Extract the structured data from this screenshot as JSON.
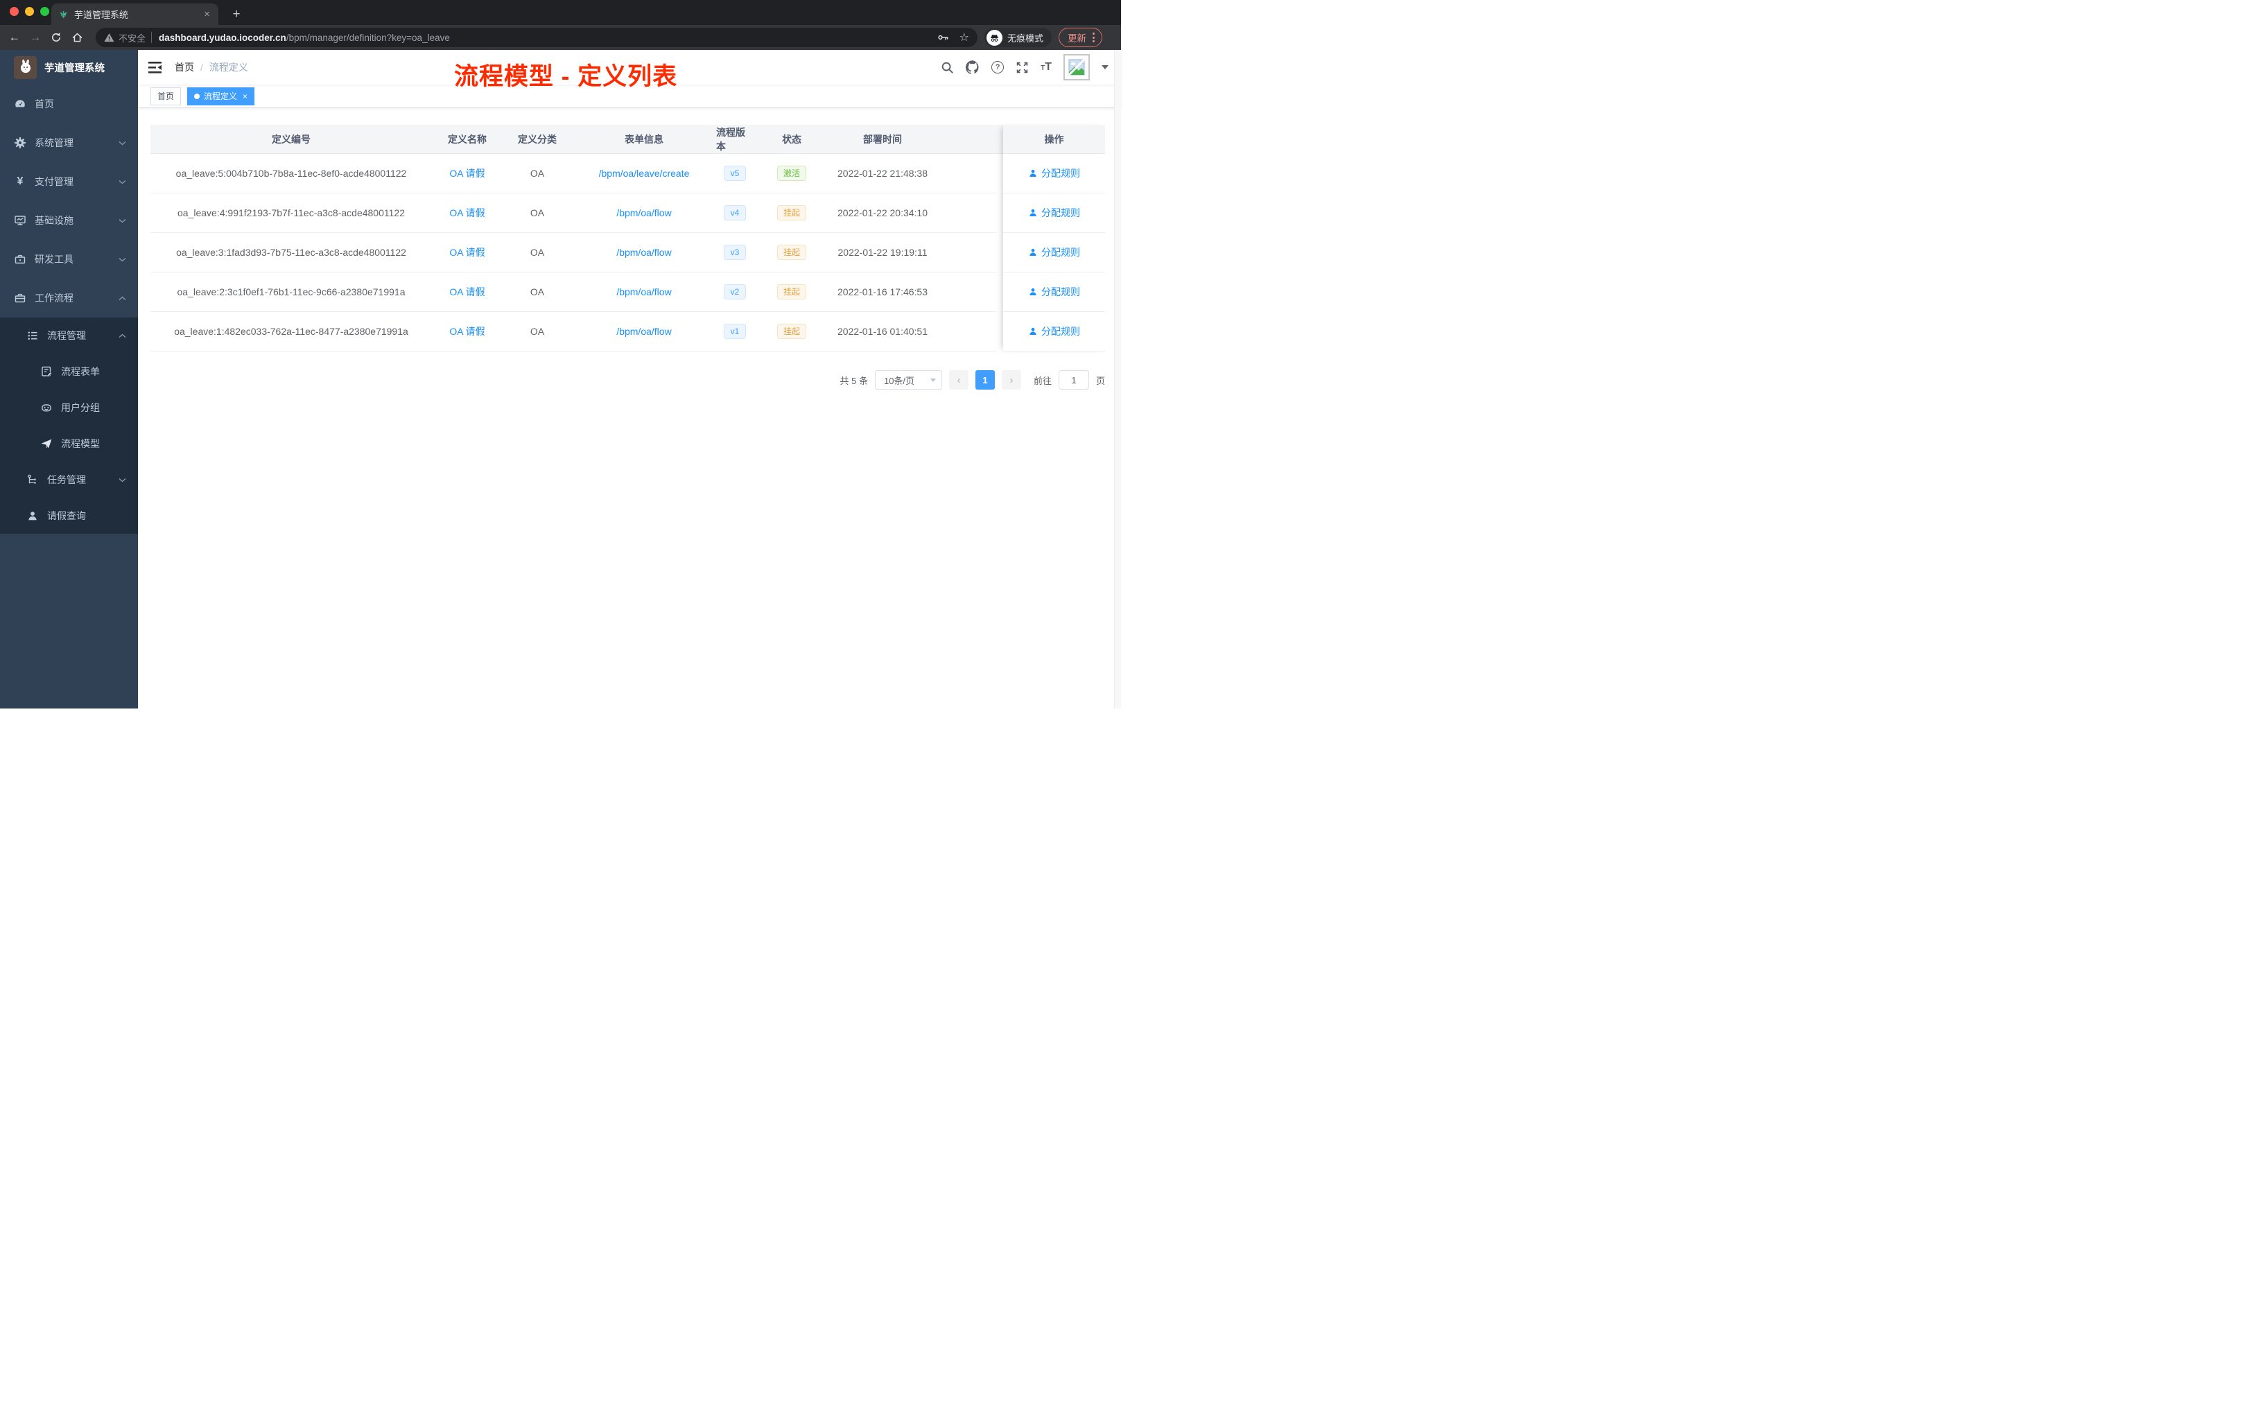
{
  "colors": {
    "accent": "#409eff",
    "link": "#1890ff",
    "success_green": "#67c23a",
    "warning_orange": "#e6a23c",
    "annotation_red": "#ff2b00",
    "sidebar_bg": "#304156",
    "submenu_bg": "#1f2d3d",
    "traffic_red": "#ff5f57",
    "traffic_yellow": "#febc2e",
    "traffic_green": "#28c840",
    "update_red": "#f08f87"
  },
  "browser": {
    "tab_title": "芋道管理系统",
    "new_tab": "+",
    "close_tab": "×",
    "back": "←",
    "forward": "→",
    "security_label": "不安全",
    "url_domain": "dashboard.yudao.iocoder.cn",
    "url_path": "/bpm/manager/definition?key=oa_leave",
    "star": "☆",
    "incognito_label": "无痕模式",
    "update_label": "更新"
  },
  "sidebar": {
    "title": "芋道管理系统",
    "items": [
      {
        "label": "首页"
      },
      {
        "label": "系统管理"
      },
      {
        "label": "支付管理"
      },
      {
        "label": "基础设施"
      },
      {
        "label": "研发工具"
      },
      {
        "label": "工作流程"
      },
      {
        "label": "流程管理"
      },
      {
        "label": "流程表单"
      },
      {
        "label": "用户分组"
      },
      {
        "label": "流程模型"
      },
      {
        "label": "任务管理"
      },
      {
        "label": "请假查询"
      }
    ],
    "yen_icon": "¥"
  },
  "navbar": {
    "breadcrumb": [
      "首页",
      "流程定义"
    ],
    "separator": "/"
  },
  "annotation": "流程模型 - 定义列表",
  "tags": [
    {
      "label": "首页"
    },
    {
      "label": "流程定义",
      "close": "×"
    }
  ],
  "table": {
    "columns": [
      "定义编号",
      "定义名称",
      "定义分类",
      "表单信息",
      "流程版本",
      "状态",
      "部署时间",
      "操作"
    ],
    "action_label": "分配规则",
    "rows": [
      {
        "id": "oa_leave:5:004b710b-7b8a-11ec-8ef0-acde48001122",
        "name": "OA 请假",
        "category": "OA",
        "form": "/bpm/oa/leave/create",
        "version": "v5",
        "status": "激活",
        "status_type": "success",
        "time": "2022-01-22 21:48:38"
      },
      {
        "id": "oa_leave:4:991f2193-7b7f-11ec-a3c8-acde48001122",
        "name": "OA 请假",
        "category": "OA",
        "form": "/bpm/oa/flow",
        "version": "v4",
        "status": "挂起",
        "status_type": "warning",
        "time": "2022-01-22 20:34:10"
      },
      {
        "id": "oa_leave:3:1fad3d93-7b75-11ec-a3c8-acde48001122",
        "name": "OA 请假",
        "category": "OA",
        "form": "/bpm/oa/flow",
        "version": "v3",
        "status": "挂起",
        "status_type": "warning",
        "time": "2022-01-22 19:19:11"
      },
      {
        "id": "oa_leave:2:3c1f0ef1-76b1-11ec-9c66-a2380e71991a",
        "name": "OA 请假",
        "category": "OA",
        "form": "/bpm/oa/flow",
        "version": "v2",
        "status": "挂起",
        "status_type": "warning",
        "time": "2022-01-16 17:46:53"
      },
      {
        "id": "oa_leave:1:482ec033-762a-11ec-8477-a2380e71991a",
        "name": "OA 请假",
        "category": "OA",
        "form": "/bpm/oa/flow",
        "version": "v1",
        "status": "挂起",
        "status_type": "warning",
        "time": "2022-01-16 01:40:51"
      }
    ]
  },
  "pagination": {
    "total": "共 5 条",
    "page_size": "10条/页",
    "prev": "‹",
    "current": "1",
    "next": "›",
    "goto": "前往",
    "unit": "页"
  }
}
